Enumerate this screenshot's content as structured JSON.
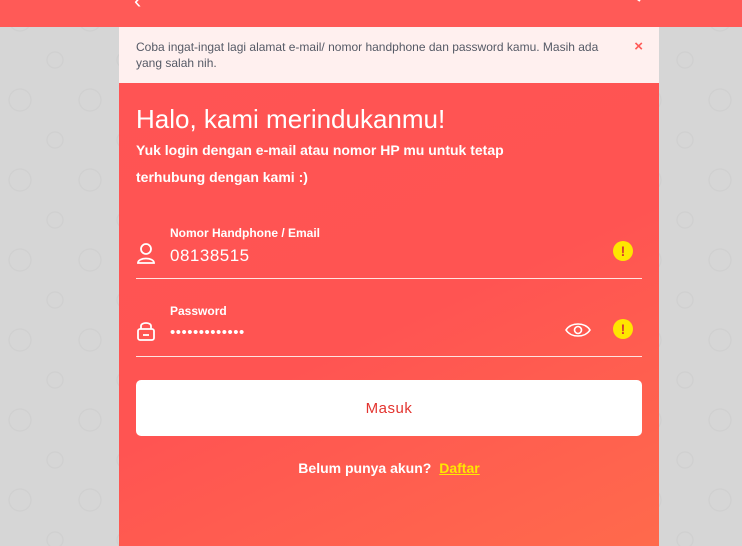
{
  "alert": {
    "message": "Coba ingat-ingat lagi alamat e-mail/ nomor handphone dan password kamu. Masih ada yang salah nih.",
    "close_symbol": "×"
  },
  "login": {
    "title": "Halo, kami merindukanmu!",
    "subtitle": "Yuk login dengan e-mail atau nomor HP mu untuk tetap terhubung dengan kami :)",
    "phone_email_label": "Nomor Handphone / Email",
    "phone_email_value": "08138515",
    "password_label": "Password",
    "password_value": "•••••••••••••",
    "submit_label": "Masuk",
    "signup_prompt": "Belum punya akun?",
    "signup_link": "Daftar"
  },
  "icons": {
    "back": "back-chevron-icon",
    "chat": "chat-icon",
    "user": "user-icon",
    "lock": "lock-icon",
    "eye": "eye-icon",
    "warning": "warning-icon"
  },
  "colors": {
    "brand": "#ff5a57",
    "warning": "#ffe600",
    "signup_link": "#ffe600",
    "alert_background": "#fff0ef"
  }
}
